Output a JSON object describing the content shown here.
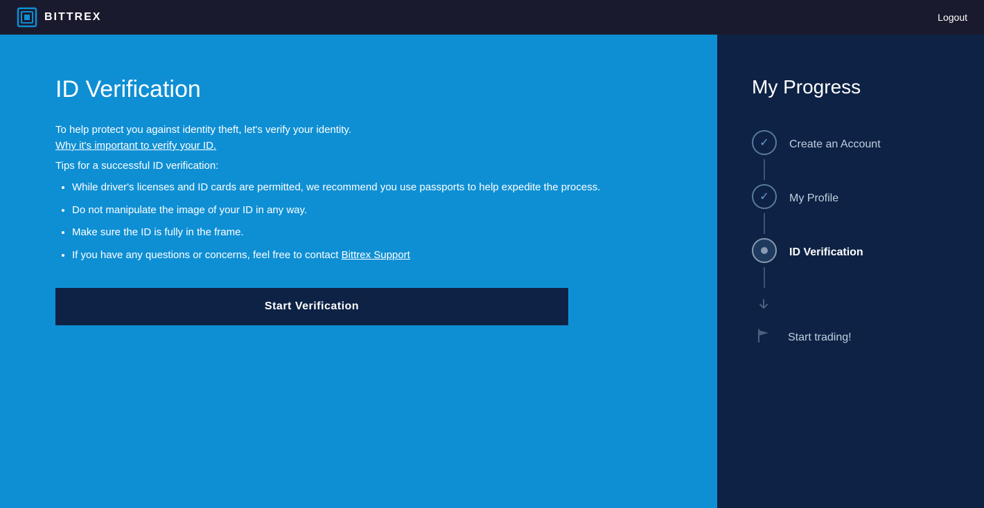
{
  "header": {
    "logo_text": "BITTREX",
    "logout_label": "Logout"
  },
  "main": {
    "page_title": "ID Verification",
    "intro_text": "To help protect you against identity theft, let's verify your identity.",
    "why_link": "Why it's important to verify your ID.",
    "tips_heading": "Tips for a successful ID verification:",
    "tips": [
      "While driver's licenses and ID cards are permitted, we recommend you use passports to help expedite the process.",
      "Do not manipulate the image of your ID in any way.",
      "Make sure the ID is fully in the frame.",
      "If you have any questions or concerns, feel free to contact"
    ],
    "support_link_text": "Bittrex Support",
    "start_button": "Start Verification"
  },
  "progress": {
    "title": "My Progress",
    "steps": [
      {
        "label": "Create an Account",
        "state": "completed"
      },
      {
        "label": "My Profile",
        "state": "completed"
      },
      {
        "label": "ID Verification",
        "state": "active"
      },
      {
        "label": "Start trading!",
        "state": "inactive"
      }
    ]
  }
}
